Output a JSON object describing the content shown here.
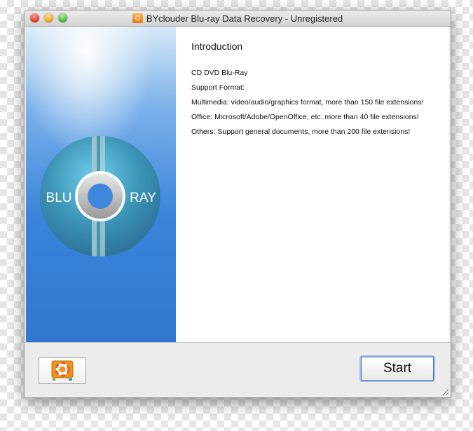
{
  "window": {
    "title": "BYclouder Blu-ray Data Recovery - Unregistered"
  },
  "side_panel": {
    "left_label": "BLU",
    "right_label": "RAY"
  },
  "info": {
    "heading": "Introduction",
    "lines": [
      "CD DVD Blu-Ray",
      "Support Format:",
      "Multimedia: video/audio/graphics format, more than 150 file extensions!",
      "Office: Microsoft/Adobe/OpenOffice, etc. more than 40 file extensions!",
      "Others: Support general documents, more than 200 file extensions!"
    ]
  },
  "footer": {
    "logo_icon": "lifebuoy-logo-icon",
    "start_label": "Start"
  },
  "colors": {
    "panel_blue": "#3a84db",
    "disc_teal": "#3a8fae",
    "start_focus": "#4a73b8"
  }
}
